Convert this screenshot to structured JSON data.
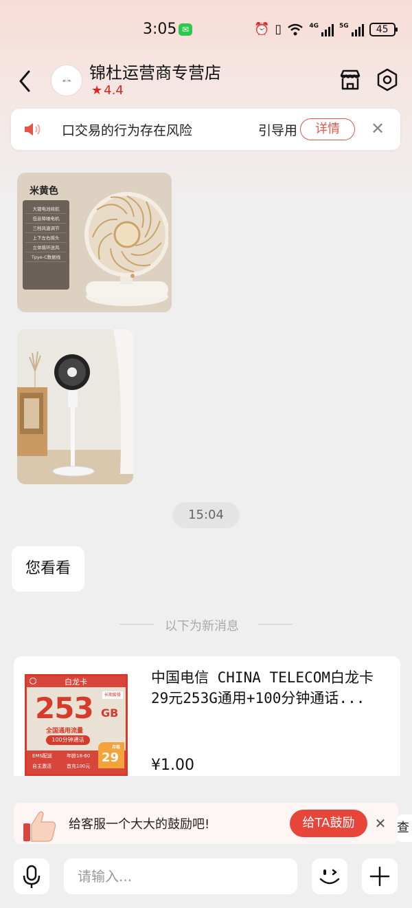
{
  "status_bar": {
    "time": "3:05",
    "battery": "45",
    "net1": "4G",
    "net2": "5G"
  },
  "header": {
    "store_name": "锦杜运营商专营店",
    "rating": "4.4",
    "accent_color": "#e2231a"
  },
  "notice": {
    "text": "⼝交易的行为存在风险",
    "text_right": "引导用",
    "detail_label": "详情",
    "close_label": "✕"
  },
  "product_image_1": {
    "color_label": "米黄色",
    "features": [
      "大镀电池续航",
      "低音降噪电机",
      "三档风速调节",
      "上下左右摇头",
      "立体循环送风",
      "Tpye-C数据线"
    ]
  },
  "time_chip": "15:04",
  "message": "您看看",
  "new_divider": "以下为新消息",
  "product_card": {
    "title": "中国电信 CHINA TELECOM白龙卡29元253G通用+100分钟通话...",
    "price": "¥1.00",
    "thumb": {
      "card_name": "白龙卡",
      "big_number": "253",
      "unit": "GB",
      "tag": "长期套餐",
      "line1": "全国通用流量",
      "line2": "100分钟通话",
      "footer_a": "EMS配送",
      "footer_b": "自主激活",
      "footer_c": "年龄18-60",
      "footer_d": "首充100元",
      "price_tag": "29",
      "price_unit": "月租"
    }
  },
  "encourage": {
    "text": "给客服一个大大的鼓励吧!",
    "button_label": "给TA鼓励",
    "close_label": "✕",
    "peek_text": "查"
  },
  "input_bar": {
    "placeholder": "请输入..."
  }
}
